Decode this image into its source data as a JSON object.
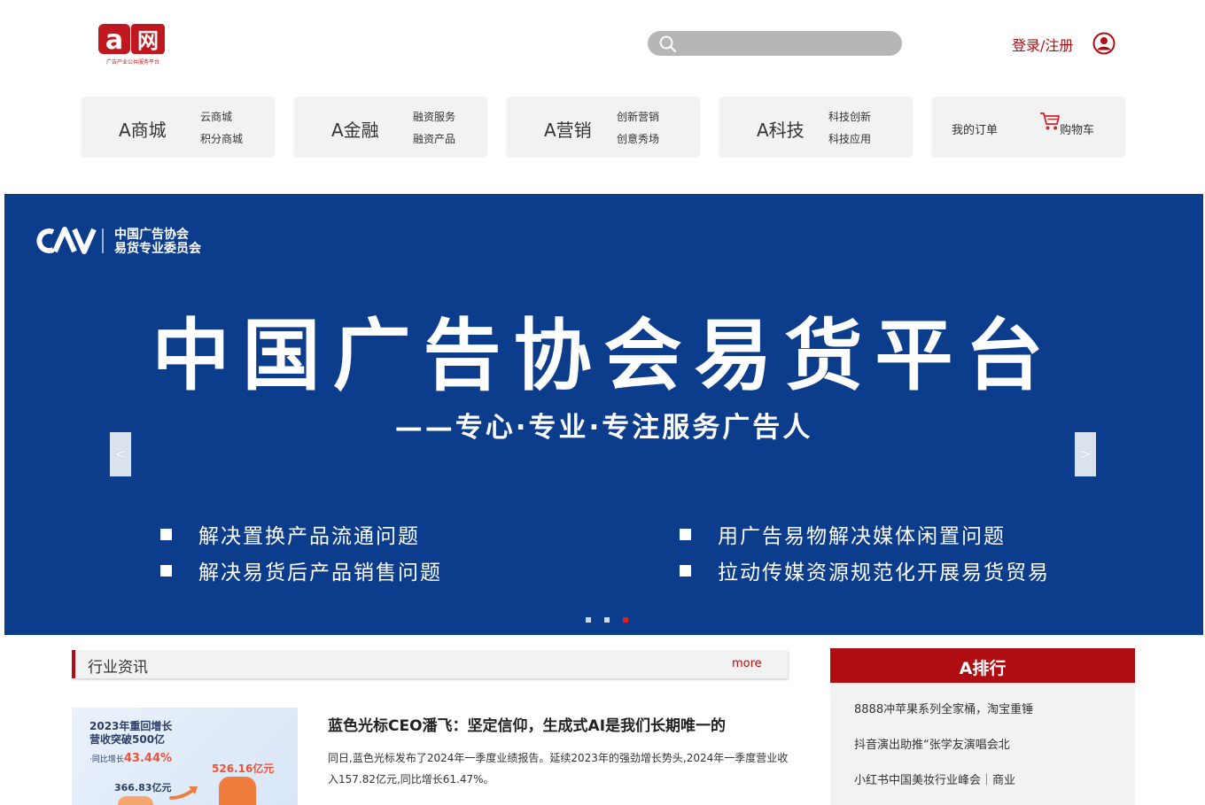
{
  "header": {
    "logo_alt": "a网",
    "logo_letter": "a",
    "logo_text": "网",
    "logo_tagline": "广告产业公共服务平台",
    "search": {
      "placeholder": ""
    },
    "login_label": "登录/注册"
  },
  "nav": [
    {
      "main": "A商城",
      "sub1": "云商城",
      "sub2": "积分商城"
    },
    {
      "main": "A金融",
      "sub1": "融资服务",
      "sub2": "融资产品"
    },
    {
      "main": "A营销",
      "sub1": "创新营销",
      "sub2": "创意秀场"
    },
    {
      "main": "A科技",
      "sub1": "科技创新",
      "sub2": "科技应用"
    }
  ],
  "orders": {
    "order_label": "我的订单",
    "cart_label": "购物车"
  },
  "banner": {
    "org_line1": "中国广告协会",
    "org_line2": "易货专业委员会",
    "title": "中国广告协会易货平台",
    "subtitle": "——专心·专业·专注服务广告人",
    "bullets": [
      "解决置换产品流通问题",
      "用广告易物解决媒体闲置问题",
      "解决易货后产品销售问题",
      "拉动传媒资源规范化开展易货贸易"
    ],
    "prev": "<",
    "next": ">",
    "slide_count": 3,
    "active_slide": 3
  },
  "news": {
    "section_title": "行业资讯",
    "more_label": "more",
    "thumb": {
      "line1": "2023年重回增长",
      "line2": "营收突破500亿",
      "growth_prefix": "·同比增长",
      "growth": "43.44%",
      "value_high": "526.16亿元",
      "value_low": "366.83亿元"
    },
    "headline": "蓝色光标CEO潘飞：坚定信仰，生成式AI是我们长期唯一的",
    "summary": "同日,蓝色光标发布了2024年一季度业绩报告。延续2023年的强劲增长势头,2024年一季度营业收入157.82亿元,同比增长61.47%。"
  },
  "ranking": {
    "title": "A排行",
    "items": [
      "8888冲苹果系列全家桶，淘宝重锤",
      "抖音演出助推“张学友演唱会北",
      "小红书中国美妆行业峰会｜商业"
    ]
  },
  "colors": {
    "brand_red": "#b00d12",
    "banner_blue": "#0c3d8d",
    "card_gray": "#f2f2f2"
  }
}
